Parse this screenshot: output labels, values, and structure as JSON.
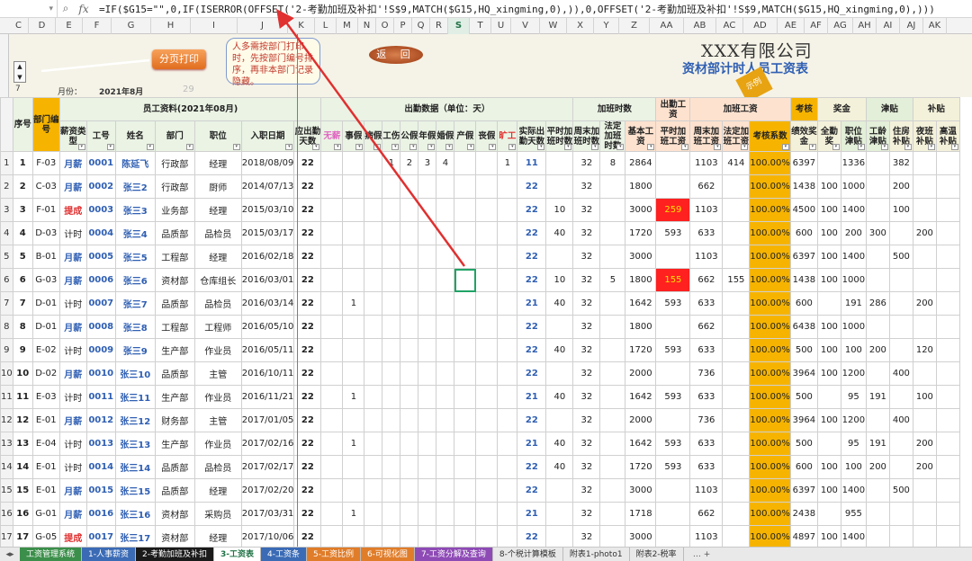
{
  "formula_bar": {
    "name_box": "",
    "formula": "=IF($G15=\"\",0,IF(ISERROR(OFFSET('2-考勤加班及补扣'!S$9,MATCH($G15,HQ_xingming,0),)),0,OFFSET('2-考勤加班及补扣'!S$9,MATCH($G15,HQ_xingming,0),)))"
  },
  "columns": [
    "C",
    "D",
    "E",
    "F",
    "G",
    "H",
    "I",
    "J",
    "K",
    "L",
    "M",
    "N",
    "O",
    "P",
    "Q",
    "R",
    "S",
    "T",
    "U",
    "V",
    "W",
    "X",
    "Y",
    "Z",
    "AA",
    "AB",
    "AC",
    "AD",
    "AE",
    "AF",
    "AG",
    "AH",
    "AI",
    "AJ",
    "AK"
  ],
  "selected_column": "S",
  "banner": {
    "row_number": "7",
    "month_label": "月份：",
    "month_value": "2021年8月",
    "value_29": "29",
    "print_button": "分页打印",
    "callout": "人多需按部门打印时，先按部门编号排序，再非本部门记录隐藏。",
    "back_button": "返 回",
    "company": "XXX有限公司",
    "subtitle": "资材部计时人员工资表",
    "stamp": "示例"
  },
  "header": {
    "seq": "序号",
    "dept_code": "部门编号",
    "basic_group": "员工资料(2021年08月)",
    "salary_type": "薪资类型",
    "emp_no": "工号",
    "name": "姓名",
    "dept": "部门",
    "position": "职位",
    "join_date": "入职日期",
    "attendance_group": "出勤数据（单位：天）",
    "att_due": "应出勤天数",
    "att_none": "无薪",
    "att_personal": "事假",
    "att_sick": "病假",
    "att_work": "工伤",
    "att_public": "公假",
    "att_annual": "年假",
    "att_marriage": "婚假",
    "att_maternity": "产假",
    "att_funeral": "丧假",
    "att_absent": "旷工",
    "att_actual": "实际出勤天数",
    "ot_group": "加班时数",
    "ot_weekday": "平时加班时数",
    "ot_weekend": "周末加班时数",
    "ot_holiday": "法定加班时数",
    "attpay_group": "出勤工资",
    "base_pay": "基本工资",
    "otpay_group": "加班工资",
    "otpay_weekday": "平时加班工资",
    "otpay_weekend": "周末加班工资",
    "otpay_holiday": "法定加班工资",
    "perf_group": "考核",
    "perf_coef": "考核系数",
    "bonus_group": "奖金",
    "bonus_perf": "绩效奖金",
    "bonus_full": "全勤奖",
    "allow_group": "津贴",
    "allow_post": "职位津贴",
    "allow_seniority": "工龄津贴",
    "subsidy_group": "补贴",
    "sub_housing": "住房补贴",
    "sub_night": "夜班补贴",
    "sub_heat": "高温补贴"
  },
  "rows": [
    {
      "rn": "1",
      "seq": "1",
      "code": "F-03",
      "type": "月薪",
      "no": "0001",
      "name": "陈延飞",
      "dept": "行政部",
      "pos": "经理",
      "date": "2018/08/09",
      "due": "22",
      "none": "",
      "pers": "",
      "sick": "",
      "work": "1",
      "pub": "2",
      "ann": "3",
      "mar": "4",
      "mat": "",
      "fun": "",
      "abs": "1",
      "act": "11",
      "otw": "",
      "otwe": "32",
      "oth": "8",
      "base": "2864",
      "pw": "",
      "pwe": "1103",
      "ph": "414",
      "coef": "100.00%",
      "perf": "6397",
      "full": "",
      "post": "1336",
      "sen": "",
      "hous": "382",
      "night": "",
      "heat": ""
    },
    {
      "rn": "2",
      "seq": "2",
      "code": "C-03",
      "type": "月薪",
      "no": "0002",
      "name": "张三2",
      "dept": "行政部",
      "pos": "厨师",
      "date": "2014/07/13",
      "due": "22",
      "none": "",
      "pers": "",
      "sick": "",
      "work": "",
      "pub": "",
      "ann": "",
      "mar": "",
      "mat": "",
      "fun": "",
      "abs": "",
      "act": "22",
      "otw": "",
      "otwe": "32",
      "oth": "",
      "base": "1800",
      "pw": "",
      "pwe": "662",
      "ph": "",
      "coef": "100.00%",
      "perf": "1438",
      "full": "100",
      "post": "1000",
      "sen": "",
      "hous": "200",
      "night": "",
      "heat": ""
    },
    {
      "rn": "3",
      "seq": "3",
      "code": "F-01",
      "type": "提成",
      "no": "0003",
      "name": "张三3",
      "dept": "业务部",
      "pos": "经理",
      "date": "2015/03/10",
      "due": "22",
      "none": "",
      "pers": "",
      "sick": "",
      "work": "",
      "pub": "",
      "ann": "",
      "mar": "",
      "mat": "",
      "fun": "",
      "abs": "",
      "act": "22",
      "otw": "10",
      "otwe": "32",
      "oth": "",
      "base": "3000",
      "pw": "259",
      "pwe": "1103",
      "ph": "",
      "coef": "100.00%",
      "perf": "4500",
      "full": "100",
      "post": "1400",
      "sen": "",
      "hous": "100",
      "night": "",
      "heat": ""
    },
    {
      "rn": "4",
      "seq": "4",
      "code": "D-03",
      "type": "计时",
      "no": "0004",
      "name": "张三4",
      "dept": "品质部",
      "pos": "品检员",
      "date": "2015/03/17",
      "due": "22",
      "none": "",
      "pers": "",
      "sick": "",
      "work": "",
      "pub": "",
      "ann": "",
      "mar": "",
      "mat": "",
      "fun": "",
      "abs": "",
      "act": "22",
      "otw": "40",
      "otwe": "32",
      "oth": "",
      "base": "1720",
      "pw": "593",
      "pwe": "633",
      "ph": "",
      "coef": "100.00%",
      "perf": "600",
      "full": "100",
      "post": "200",
      "sen": "300",
      "hous": "",
      "night": "200",
      "heat": ""
    },
    {
      "rn": "5",
      "seq": "5",
      "code": "B-01",
      "type": "月薪",
      "no": "0005",
      "name": "张三5",
      "dept": "工程部",
      "pos": "经理",
      "date": "2016/02/18",
      "due": "22",
      "none": "",
      "pers": "",
      "sick": "",
      "work": "",
      "pub": "",
      "ann": "",
      "mar": "",
      "mat": "",
      "fun": "",
      "abs": "",
      "act": "22",
      "otw": "",
      "otwe": "32",
      "oth": "",
      "base": "3000",
      "pw": "",
      "pwe": "1103",
      "ph": "",
      "coef": "100.00%",
      "perf": "6397",
      "full": "100",
      "post": "1400",
      "sen": "",
      "hous": "500",
      "night": "",
      "heat": ""
    },
    {
      "rn": "6",
      "seq": "6",
      "code": "G-03",
      "type": "月薪",
      "no": "0006",
      "name": "张三6",
      "dept": "资材部",
      "pos": "仓库组长",
      "date": "2016/03/01",
      "due": "22",
      "none": "",
      "pers": "",
      "sick": "",
      "work": "",
      "pub": "",
      "ann": "",
      "mar": "",
      "mat": "",
      "fun": "",
      "abs": "",
      "act": "22",
      "otw": "10",
      "otwe": "32",
      "oth": "5",
      "base": "1800",
      "pw": "155",
      "pwe": "662",
      "ph": "155",
      "coef": "100.00%",
      "perf": "1438",
      "full": "100",
      "post": "1000",
      "sen": "",
      "hous": "",
      "night": "",
      "heat": ""
    },
    {
      "rn": "7",
      "seq": "7",
      "code": "D-01",
      "type": "计时",
      "no": "0007",
      "name": "张三7",
      "dept": "品质部",
      "pos": "品检员",
      "date": "2016/03/14",
      "due": "22",
      "none": "",
      "pers": "1",
      "sick": "",
      "work": "",
      "pub": "",
      "ann": "",
      "mar": "",
      "mat": "",
      "fun": "",
      "abs": "",
      "act": "21",
      "otw": "40",
      "otwe": "32",
      "oth": "",
      "base": "1642",
      "pw": "593",
      "pwe": "633",
      "ph": "",
      "coef": "100.00%",
      "perf": "600",
      "full": "",
      "post": "191",
      "sen": "286",
      "hous": "",
      "night": "200",
      "heat": ""
    },
    {
      "rn": "8",
      "seq": "8",
      "code": "D-01",
      "type": "月薪",
      "no": "0008",
      "name": "张三8",
      "dept": "工程部",
      "pos": "工程师",
      "date": "2016/05/10",
      "due": "22",
      "none": "",
      "pers": "",
      "sick": "",
      "work": "",
      "pub": "",
      "ann": "",
      "mar": "",
      "mat": "",
      "fun": "",
      "abs": "",
      "act": "22",
      "otw": "",
      "otwe": "32",
      "oth": "",
      "base": "1800",
      "pw": "",
      "pwe": "662",
      "ph": "",
      "coef": "100.00%",
      "perf": "6438",
      "full": "100",
      "post": "1000",
      "sen": "",
      "hous": "",
      "night": "",
      "heat": ""
    },
    {
      "rn": "9",
      "seq": "9",
      "code": "E-02",
      "type": "计时",
      "no": "0009",
      "name": "张三9",
      "dept": "生产部",
      "pos": "作业员",
      "date": "2016/05/11",
      "due": "22",
      "none": "",
      "pers": "",
      "sick": "",
      "work": "",
      "pub": "",
      "ann": "",
      "mar": "",
      "mat": "",
      "fun": "",
      "abs": "",
      "act": "22",
      "otw": "40",
      "otwe": "32",
      "oth": "",
      "base": "1720",
      "pw": "593",
      "pwe": "633",
      "ph": "",
      "coef": "100.00%",
      "perf": "500",
      "full": "100",
      "post": "100",
      "sen": "200",
      "hous": "",
      "night": "120",
      "heat": ""
    },
    {
      "rn": "10",
      "seq": "10",
      "code": "D-02",
      "type": "月薪",
      "no": "0010",
      "name": "张三10",
      "dept": "品质部",
      "pos": "主管",
      "date": "2016/10/11",
      "due": "22",
      "none": "",
      "pers": "",
      "sick": "",
      "work": "",
      "pub": "",
      "ann": "",
      "mar": "",
      "mat": "",
      "fun": "",
      "abs": "",
      "act": "22",
      "otw": "",
      "otwe": "32",
      "oth": "",
      "base": "2000",
      "pw": "",
      "pwe": "736",
      "ph": "",
      "coef": "100.00%",
      "perf": "3964",
      "full": "100",
      "post": "1200",
      "sen": "",
      "hous": "400",
      "night": "",
      "heat": ""
    },
    {
      "rn": "11",
      "seq": "11",
      "code": "E-03",
      "type": "计时",
      "no": "0011",
      "name": "张三11",
      "dept": "生产部",
      "pos": "作业员",
      "date": "2016/11/21",
      "due": "22",
      "none": "",
      "pers": "1",
      "sick": "",
      "work": "",
      "pub": "",
      "ann": "",
      "mar": "",
      "mat": "",
      "fun": "",
      "abs": "",
      "act": "21",
      "otw": "40",
      "otwe": "32",
      "oth": "",
      "base": "1642",
      "pw": "593",
      "pwe": "633",
      "ph": "",
      "coef": "100.00%",
      "perf": "500",
      "full": "",
      "post": "95",
      "sen": "191",
      "hous": "",
      "night": "100",
      "heat": ""
    },
    {
      "rn": "12",
      "seq": "12",
      "code": "E-01",
      "type": "月薪",
      "no": "0012",
      "name": "张三12",
      "dept": "财务部",
      "pos": "主管",
      "date": "2017/01/05",
      "due": "22",
      "none": "",
      "pers": "",
      "sick": "",
      "work": "",
      "pub": "",
      "ann": "",
      "mar": "",
      "mat": "",
      "fun": "",
      "abs": "",
      "act": "22",
      "otw": "",
      "otwe": "32",
      "oth": "",
      "base": "2000",
      "pw": "",
      "pwe": "736",
      "ph": "",
      "coef": "100.00%",
      "perf": "3964",
      "full": "100",
      "post": "1200",
      "sen": "",
      "hous": "400",
      "night": "",
      "heat": ""
    },
    {
      "rn": "13",
      "seq": "13",
      "code": "E-04",
      "type": "计时",
      "no": "0013",
      "name": "张三13",
      "dept": "生产部",
      "pos": "作业员",
      "date": "2017/02/16",
      "due": "22",
      "none": "",
      "pers": "1",
      "sick": "",
      "work": "",
      "pub": "",
      "ann": "",
      "mar": "",
      "mat": "",
      "fun": "",
      "abs": "",
      "act": "21",
      "otw": "40",
      "otwe": "32",
      "oth": "",
      "base": "1642",
      "pw": "593",
      "pwe": "633",
      "ph": "",
      "coef": "100.00%",
      "perf": "500",
      "full": "",
      "post": "95",
      "sen": "191",
      "hous": "",
      "night": "200",
      "heat": ""
    },
    {
      "rn": "14",
      "seq": "14",
      "code": "E-01",
      "type": "计时",
      "no": "0014",
      "name": "张三14",
      "dept": "品质部",
      "pos": "品检员",
      "date": "2017/02/17",
      "due": "22",
      "none": "",
      "pers": "",
      "sick": "",
      "work": "",
      "pub": "",
      "ann": "",
      "mar": "",
      "mat": "",
      "fun": "",
      "abs": "",
      "act": "22",
      "otw": "40",
      "otwe": "32",
      "oth": "",
      "base": "1720",
      "pw": "593",
      "pwe": "633",
      "ph": "",
      "coef": "100.00%",
      "perf": "600",
      "full": "100",
      "post": "100",
      "sen": "200",
      "hous": "",
      "night": "200",
      "heat": ""
    },
    {
      "rn": "15",
      "seq": "15",
      "code": "E-01",
      "type": "月薪",
      "no": "0015",
      "name": "张三15",
      "dept": "品质部",
      "pos": "经理",
      "date": "2017/02/20",
      "due": "22",
      "none": "",
      "pers": "",
      "sick": "",
      "work": "",
      "pub": "",
      "ann": "",
      "mar": "",
      "mat": "",
      "fun": "",
      "abs": "",
      "act": "22",
      "otw": "",
      "otwe": "32",
      "oth": "",
      "base": "3000",
      "pw": "",
      "pwe": "1103",
      "ph": "",
      "coef": "100.00%",
      "perf": "6397",
      "full": "100",
      "post": "1400",
      "sen": "",
      "hous": "500",
      "night": "",
      "heat": ""
    },
    {
      "rn": "16",
      "seq": "16",
      "code": "G-01",
      "type": "月薪",
      "no": "0016",
      "name": "张三16",
      "dept": "资材部",
      "pos": "采购员",
      "date": "2017/03/31",
      "due": "22",
      "none": "",
      "pers": "1",
      "sick": "",
      "work": "",
      "pub": "",
      "ann": "",
      "mar": "",
      "mat": "",
      "fun": "",
      "abs": "",
      "act": "21",
      "otw": "",
      "otwe": "32",
      "oth": "",
      "base": "1718",
      "pw": "",
      "pwe": "662",
      "ph": "",
      "coef": "100.00%",
      "perf": "2438",
      "full": "",
      "post": "955",
      "sen": "",
      "hous": "",
      "night": "",
      "heat": ""
    },
    {
      "rn": "17",
      "seq": "17",
      "code": "G-05",
      "type": "提成",
      "no": "0017",
      "name": "张三17",
      "dept": "资材部",
      "pos": "经理",
      "date": "2017/10/06",
      "due": "22",
      "none": "",
      "pers": "",
      "sick": "",
      "work": "",
      "pub": "",
      "ann": "",
      "mar": "",
      "mat": "",
      "fun": "",
      "abs": "",
      "act": "22",
      "otw": "",
      "otwe": "32",
      "oth": "",
      "base": "3000",
      "pw": "",
      "pwe": "1103",
      "ph": "",
      "coef": "100.00%",
      "perf": "4897",
      "full": "100",
      "post": "1400",
      "sen": "",
      "hous": "",
      "night": "",
      "heat": ""
    }
  ],
  "tabs": [
    {
      "label": "工资管理系统",
      "color": "#3c8f4b"
    },
    {
      "label": "1-人事薪资",
      "color": "#3b6bb5"
    },
    {
      "label": "2-考勤加班及补扣",
      "color": "#1a1a1a"
    },
    {
      "label": "3-工资表",
      "color": "#ffffff",
      "active": true
    },
    {
      "label": "4-工资条",
      "color": "#3b6bb5"
    },
    {
      "label": "5-工资比例",
      "color": "#e07d2a"
    },
    {
      "label": "6-可视化图",
      "color": "#e07d2a"
    },
    {
      "label": "7-工资分解及查询",
      "color": "#8e4bb5"
    },
    {
      "label": "8-个税计算模板",
      "color": "#e9e9e9"
    },
    {
      "label": "附表1-photo1",
      "color": "#e9e9e9"
    },
    {
      "label": "附表2-税率",
      "color": "#e9e9e9"
    }
  ],
  "tab_extra": "…  +",
  "colors": {
    "accent": "#217346",
    "perf_column": "#f6b400",
    "highlight_red": "#ff2020",
    "arrow": "#e03030"
  }
}
